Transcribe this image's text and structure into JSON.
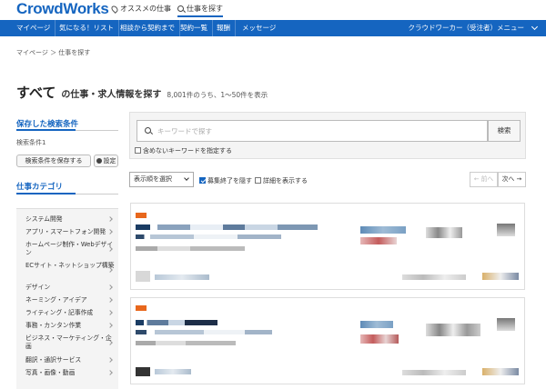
{
  "header": {
    "logo": "CrowdWorks",
    "links": [
      {
        "label": "オススメの仕事",
        "icon": "pin-icon"
      },
      {
        "label": "仕事を探す",
        "icon": "search-icon",
        "active": true
      }
    ]
  },
  "nav": {
    "items": [
      "マイページ",
      "気になる！リスト",
      "相談から契約まで",
      "契約一覧",
      "報酬",
      "メッセージ"
    ],
    "user_menu": "クラウドワーカー（受注者）メニュー"
  },
  "breadcrumb": "マイページ ＞ 仕事を探す",
  "title": {
    "main": "すべて",
    "sub": "の仕事・求人情報を探す",
    "count": "8,001件のうち、1〜50件を表示"
  },
  "sidebar": {
    "saved_heading": "保存した検索条件",
    "condition": "検索条件1",
    "save_button": "検索条件を保存する",
    "settings_button": "設定",
    "category_heading": "仕事カテゴリ",
    "categories": [
      "システム開発",
      "アプリ・スマートフォン開発",
      "ホームページ制作・Webデザイン",
      "ECサイト・ネットショップ構築",
      "デザイン",
      "ネーミング・アイデア",
      "ライティング・記事作成",
      "事務・カンタン作業",
      "ビジネス・マーケティング・企画",
      "翻訳・通訳サービス",
      "写真・画像・動画"
    ]
  },
  "search": {
    "placeholder": "キーワードで探す",
    "button": "検索",
    "exclude_label": "含めないキーワードを指定する"
  },
  "filters": {
    "sort": "表示順を選択",
    "hide_closed": "募集終了を隠す",
    "hide_closed_checked": true,
    "show_details": "詳細を表示する",
    "show_details_checked": false,
    "prev": "← 前へ",
    "next": "次へ →"
  },
  "colors": {
    "brand": "#1565c0",
    "accent_orange": "#e8671c"
  }
}
